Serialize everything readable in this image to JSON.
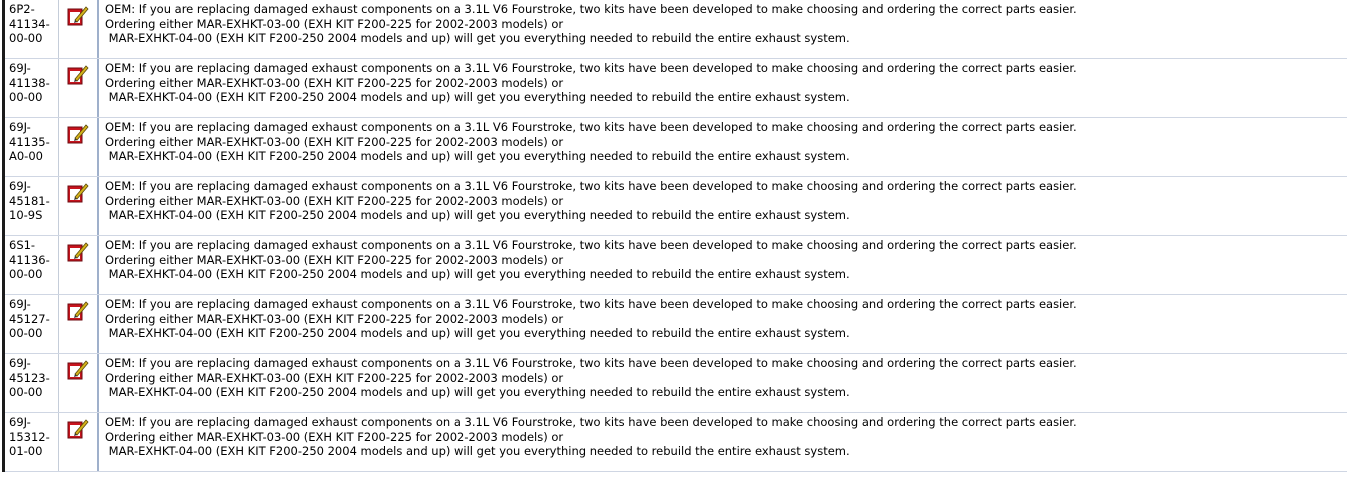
{
  "rows": [
    {
      "part_lines": [
        "6P2-",
        "41134-",
        "00-00"
      ],
      "icon": "notepad-pencil-icon",
      "note_lines": [
        "OEM: If you are replacing damaged exhaust components on a 3.1L V6 Fourstroke, two kits have been developed to make choosing and ordering the correct parts easier.",
        "Ordering either MAR-EXHKT-03-00 (EXH KIT F200-225 for 2002-2003 models) or",
        " MAR-EXHKT-04-00 (EXH KIT F200-250 2004 models and up) will get you everything needed to rebuild the entire exhaust system."
      ]
    },
    {
      "part_lines": [
        "69J-",
        "41138-",
        "00-00"
      ],
      "icon": "notepad-pencil-icon",
      "note_lines": [
        "OEM: If you are replacing damaged exhaust components on a 3.1L V6 Fourstroke, two kits have been developed to make choosing and ordering the correct parts easier.",
        "Ordering either MAR-EXHKT-03-00 (EXH KIT F200-225 for 2002-2003 models) or",
        " MAR-EXHKT-04-00 (EXH KIT F200-250 2004 models and up) will get you everything needed to rebuild the entire exhaust system."
      ]
    },
    {
      "part_lines": [
        "69J-",
        "41135-",
        "A0-00"
      ],
      "icon": "notepad-pencil-icon",
      "note_lines": [
        "OEM: If you are replacing damaged exhaust components on a 3.1L V6 Fourstroke, two kits have been developed to make choosing and ordering the correct parts easier.",
        "Ordering either MAR-EXHKT-03-00 (EXH KIT F200-225 for 2002-2003 models) or",
        " MAR-EXHKT-04-00 (EXH KIT F200-250 2004 models and up) will get you everything needed to rebuild the entire exhaust system."
      ]
    },
    {
      "part_lines": [
        "69J-",
        "45181-",
        "10-9S"
      ],
      "icon": "notepad-pencil-icon",
      "note_lines": [
        "OEM: If you are replacing damaged exhaust components on a 3.1L V6 Fourstroke, two kits have been developed to make choosing and ordering the correct parts easier.",
        "Ordering either MAR-EXHKT-03-00 (EXH KIT F200-225 for 2002-2003 models) or",
        " MAR-EXHKT-04-00 (EXH KIT F200-250 2004 models and up) will get you everything needed to rebuild the entire exhaust system."
      ]
    },
    {
      "part_lines": [
        "6S1-",
        "41136-",
        "00-00"
      ],
      "icon": "notepad-pencil-icon",
      "note_lines": [
        "OEM: If you are replacing damaged exhaust components on a 3.1L V6 Fourstroke, two kits have been developed to make choosing and ordering the correct parts easier.",
        "Ordering either MAR-EXHKT-03-00 (EXH KIT F200-225 for 2002-2003 models) or",
        " MAR-EXHKT-04-00 (EXH KIT F200-250 2004 models and up) will get you everything needed to rebuild the entire exhaust system."
      ]
    },
    {
      "part_lines": [
        "69J-",
        "45127-",
        "00-00"
      ],
      "icon": "notepad-pencil-icon",
      "note_lines": [
        "OEM: If you are replacing damaged exhaust components on a 3.1L V6 Fourstroke, two kits have been developed to make choosing and ordering the correct parts easier.",
        "Ordering either MAR-EXHKT-03-00 (EXH KIT F200-225 for 2002-2003 models) or",
        " MAR-EXHKT-04-00 (EXH KIT F200-250 2004 models and up) will get you everything needed to rebuild the entire exhaust system."
      ]
    },
    {
      "part_lines": [
        "69J-",
        "45123-",
        "00-00"
      ],
      "icon": "notepad-pencil-icon",
      "note_lines": [
        "OEM: If you are replacing damaged exhaust components on a 3.1L V6 Fourstroke, two kits have been developed to make choosing and ordering the correct parts easier.",
        "Ordering either MAR-EXHKT-03-00 (EXH KIT F200-225 for 2002-2003 models) or",
        " MAR-EXHKT-04-00 (EXH KIT F200-250 2004 models and up) will get you everything needed to rebuild the entire exhaust system."
      ]
    },
    {
      "part_lines": [
        "69J-",
        "15312-",
        "01-00"
      ],
      "icon": "notepad-pencil-icon",
      "note_lines": [
        "OEM: If you are replacing damaged exhaust components on a 3.1L V6 Fourstroke, two kits have been developed to make choosing and ordering the correct parts easier.",
        "Ordering either MAR-EXHKT-03-00 (EXH KIT F200-225 for 2002-2003 models) or",
        " MAR-EXHKT-04-00 (EXH KIT F200-250 2004 models and up) will get you everything needed to rebuild the entire exhaust system."
      ]
    }
  ]
}
